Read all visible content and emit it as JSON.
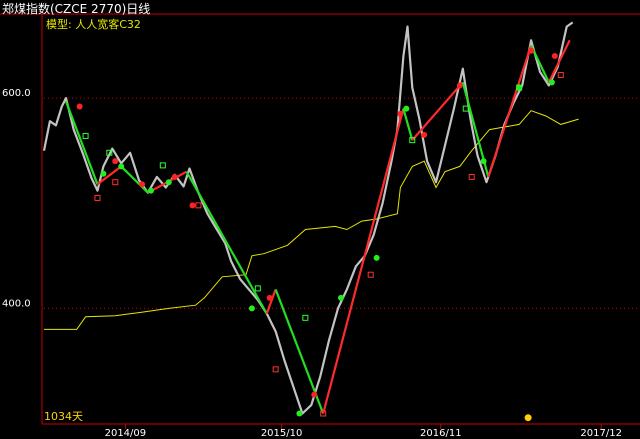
{
  "header": {
    "title": "郑煤指数(CZCE 2770)日线",
    "model_label": "模型: 人人宽客C32"
  },
  "footer": {
    "days_label": "1034天"
  },
  "colors": {
    "background": "#000000",
    "axis": "#cc0000",
    "price": "#d8d8d8",
    "model_line": "#e6e600",
    "up_trend": "#ff2a2a",
    "down_trend": "#22dd22",
    "grid": "#cc0000"
  },
  "chart_data": {
    "type": "line",
    "title": "郑煤指数(CZCE 2770)日线",
    "ylim": [
      290,
      680
    ],
    "yticks": [
      {
        "value": 400,
        "label": "400.0"
      },
      {
        "value": 600,
        "label": "600.0"
      }
    ],
    "xticks": [
      {
        "pos": 0.137,
        "label": "2014/09"
      },
      {
        "pos": 0.4,
        "label": "2015/10"
      },
      {
        "pos": 0.668,
        "label": "2016/11"
      },
      {
        "pos": 0.938,
        "label": "2017/12"
      }
    ],
    "series": [
      {
        "role": "price",
        "values": [
          [
            0,
            550
          ],
          [
            0.01,
            578
          ],
          [
            0.02,
            574
          ],
          [
            0.03,
            592
          ],
          [
            0.037,
            600
          ],
          [
            0.05,
            570
          ],
          [
            0.065,
            548
          ],
          [
            0.08,
            524
          ],
          [
            0.09,
            512
          ],
          [
            0.1,
            535
          ],
          [
            0.115,
            552
          ],
          [
            0.13,
            538
          ],
          [
            0.145,
            548
          ],
          [
            0.16,
            522
          ],
          [
            0.175,
            510
          ],
          [
            0.19,
            525
          ],
          [
            0.205,
            515
          ],
          [
            0.22,
            527
          ],
          [
            0.235,
            516
          ],
          [
            0.245,
            533
          ],
          [
            0.26,
            510
          ],
          [
            0.275,
            490
          ],
          [
            0.29,
            476
          ],
          [
            0.305,
            462
          ],
          [
            0.315,
            445
          ],
          [
            0.33,
            428
          ],
          [
            0.345,
            418
          ],
          [
            0.36,
            408
          ],
          [
            0.375,
            395
          ],
          [
            0.39,
            378
          ],
          [
            0.405,
            350
          ],
          [
            0.42,
            325
          ],
          [
            0.435,
            300
          ],
          [
            0.45,
            308
          ],
          [
            0.465,
            335
          ],
          [
            0.48,
            370
          ],
          [
            0.495,
            400
          ],
          [
            0.51,
            418
          ],
          [
            0.525,
            440
          ],
          [
            0.54,
            450
          ],
          [
            0.555,
            470
          ],
          [
            0.57,
            500
          ],
          [
            0.585,
            540
          ],
          [
            0.595,
            570
          ],
          [
            0.605,
            640
          ],
          [
            0.612,
            668
          ],
          [
            0.62,
            610
          ],
          [
            0.632,
            580
          ],
          [
            0.645,
            540
          ],
          [
            0.66,
            520
          ],
          [
            0.675,
            555
          ],
          [
            0.69,
            590
          ],
          [
            0.705,
            628
          ],
          [
            0.718,
            580
          ],
          [
            0.73,
            545
          ],
          [
            0.745,
            520
          ],
          [
            0.76,
            545
          ],
          [
            0.775,
            575
          ],
          [
            0.79,
            595
          ],
          [
            0.805,
            612
          ],
          [
            0.82,
            655
          ],
          [
            0.835,
            625
          ],
          [
            0.85,
            612
          ],
          [
            0.865,
            630
          ],
          [
            0.88,
            668
          ],
          [
            0.89,
            672
          ]
        ]
      },
      {
        "role": "model",
        "values": [
          [
            0,
            380
          ],
          [
            0.055,
            380
          ],
          [
            0.07,
            392
          ],
          [
            0.12,
            393
          ],
          [
            0.16,
            396
          ],
          [
            0.21,
            400
          ],
          [
            0.255,
            403
          ],
          [
            0.27,
            410
          ],
          [
            0.3,
            430
          ],
          [
            0.34,
            432
          ],
          [
            0.35,
            450
          ],
          [
            0.37,
            452
          ],
          [
            0.41,
            460
          ],
          [
            0.44,
            475
          ],
          [
            0.49,
            478
          ],
          [
            0.51,
            475
          ],
          [
            0.535,
            483
          ],
          [
            0.56,
            485
          ],
          [
            0.595,
            490
          ],
          [
            0.6,
            515
          ],
          [
            0.62,
            535
          ],
          [
            0.64,
            540
          ],
          [
            0.66,
            515
          ],
          [
            0.675,
            530
          ],
          [
            0.7,
            535
          ],
          [
            0.72,
            550
          ],
          [
            0.75,
            570
          ],
          [
            0.8,
            575
          ],
          [
            0.82,
            588
          ],
          [
            0.845,
            583
          ],
          [
            0.87,
            575
          ],
          [
            0.9,
            580
          ]
        ]
      },
      {
        "role": "trend",
        "segments": [
          {
            "dir": "down",
            "from": [
              0.037,
              597
            ],
            "to": [
              0.09,
              518
            ]
          },
          {
            "dir": "up",
            "from": [
              0.09,
              518
            ],
            "to": [
              0.13,
              535
            ]
          },
          {
            "dir": "down",
            "from": [
              0.13,
              535
            ],
            "to": [
              0.175,
              510
            ]
          },
          {
            "dir": "up",
            "from": [
              0.175,
              510
            ],
            "to": [
              0.24,
              530
            ]
          },
          {
            "dir": "down",
            "from": [
              0.24,
              530
            ],
            "to": [
              0.375,
              395
            ]
          },
          {
            "dir": "up",
            "from": [
              0.375,
              395
            ],
            "to": [
              0.39,
              418
            ]
          },
          {
            "dir": "down",
            "from": [
              0.39,
              418
            ],
            "to": [
              0.47,
              300
            ]
          },
          {
            "dir": "up",
            "from": [
              0.47,
              300
            ],
            "to": [
              0.605,
              590
            ]
          },
          {
            "dir": "down",
            "from": [
              0.605,
              590
            ],
            "to": [
              0.62,
              560
            ]
          },
          {
            "dir": "up",
            "from": [
              0.62,
              560
            ],
            "to": [
              0.705,
              615
            ]
          },
          {
            "dir": "down",
            "from": [
              0.705,
              615
            ],
            "to": [
              0.748,
              525
            ]
          },
          {
            "dir": "up",
            "from": [
              0.748,
              525
            ],
            "to": [
              0.82,
              650
            ]
          },
          {
            "dir": "down",
            "from": [
              0.82,
              650
            ],
            "to": [
              0.85,
              615
            ]
          },
          {
            "dir": "up",
            "from": [
              0.85,
              615
            ],
            "to": [
              0.885,
              655
            ]
          }
        ]
      }
    ],
    "markers": {
      "buy": [
        [
          0.1,
          528
        ],
        [
          0.13,
          535
        ],
        [
          0.18,
          512
        ],
        [
          0.21,
          520
        ],
        [
          0.35,
          400
        ],
        [
          0.43,
          300
        ],
        [
          0.5,
          410
        ],
        [
          0.56,
          448
        ],
        [
          0.61,
          590
        ],
        [
          0.74,
          540
        ],
        [
          0.8,
          610
        ],
        [
          0.855,
          615
        ]
      ],
      "sell": [
        [
          0.06,
          592
        ],
        [
          0.12,
          540
        ],
        [
          0.165,
          518
        ],
        [
          0.22,
          525
        ],
        [
          0.25,
          498
        ],
        [
          0.38,
          410
        ],
        [
          0.455,
          318
        ],
        [
          0.6,
          585
        ],
        [
          0.64,
          565
        ],
        [
          0.7,
          612
        ],
        [
          0.82,
          645
        ],
        [
          0.86,
          640
        ]
      ]
    },
    "hollow": {
      "red": [
        [
          0.09,
          505
        ],
        [
          0.12,
          520
        ],
        [
          0.26,
          498
        ],
        [
          0.39,
          342
        ],
        [
          0.47,
          300
        ],
        [
          0.55,
          432
        ],
        [
          0.72,
          525
        ],
        [
          0.87,
          622
        ]
      ],
      "green": [
        [
          0.07,
          564
        ],
        [
          0.11,
          548
        ],
        [
          0.2,
          536
        ],
        [
          0.36,
          419
        ],
        [
          0.44,
          391
        ],
        [
          0.62,
          560
        ],
        [
          0.71,
          590
        ],
        [
          0.8,
          610
        ]
      ]
    },
    "dot": [
      0.815,
      296
    ]
  }
}
